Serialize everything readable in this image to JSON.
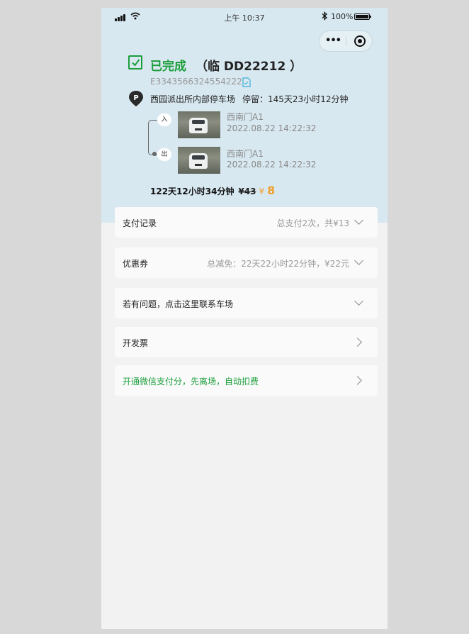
{
  "statusbar": {
    "time": "上午 10:37",
    "battery": "100%",
    "signal_icon": "signal-icon",
    "wifi_icon": "wifi-icon",
    "bluetooth_icon": "bluetooth-icon"
  },
  "capsule": {
    "more_label": "•••"
  },
  "order": {
    "status": "已完成",
    "plate": "（临 DD22212 ）",
    "order_id": "E3343566324554222",
    "lot_name": "西园派出所内部停车场",
    "stay": "停留：145天23小时12分钟",
    "entry": {
      "badge": "入",
      "gate": "西南门A1",
      "time": "2022.08.22 14:22:32"
    },
    "exit": {
      "badge": "出",
      "gate": "西南门A1",
      "time": "2022.08.22 14:22:32"
    },
    "duration": "122天12小时34分钟",
    "original_price": "¥43",
    "currency": "¥",
    "final_price": "8"
  },
  "cards": {
    "payment": {
      "label": "支付记录",
      "info": "总支付2次，共¥13"
    },
    "coupon": {
      "label": "优惠券",
      "info": "总减免：22天22小时22分钟，¥22元"
    },
    "contact": {
      "label": "若有问题，点击这里联系车场"
    },
    "invoice": {
      "label": "开发票"
    },
    "wechat": {
      "label": "开通微信支付分，先离场，自动扣费"
    }
  },
  "colors": {
    "accent_green": "#1a9e3a",
    "price_orange": "#f0a030",
    "hero_bg": "#d8e8f0"
  }
}
